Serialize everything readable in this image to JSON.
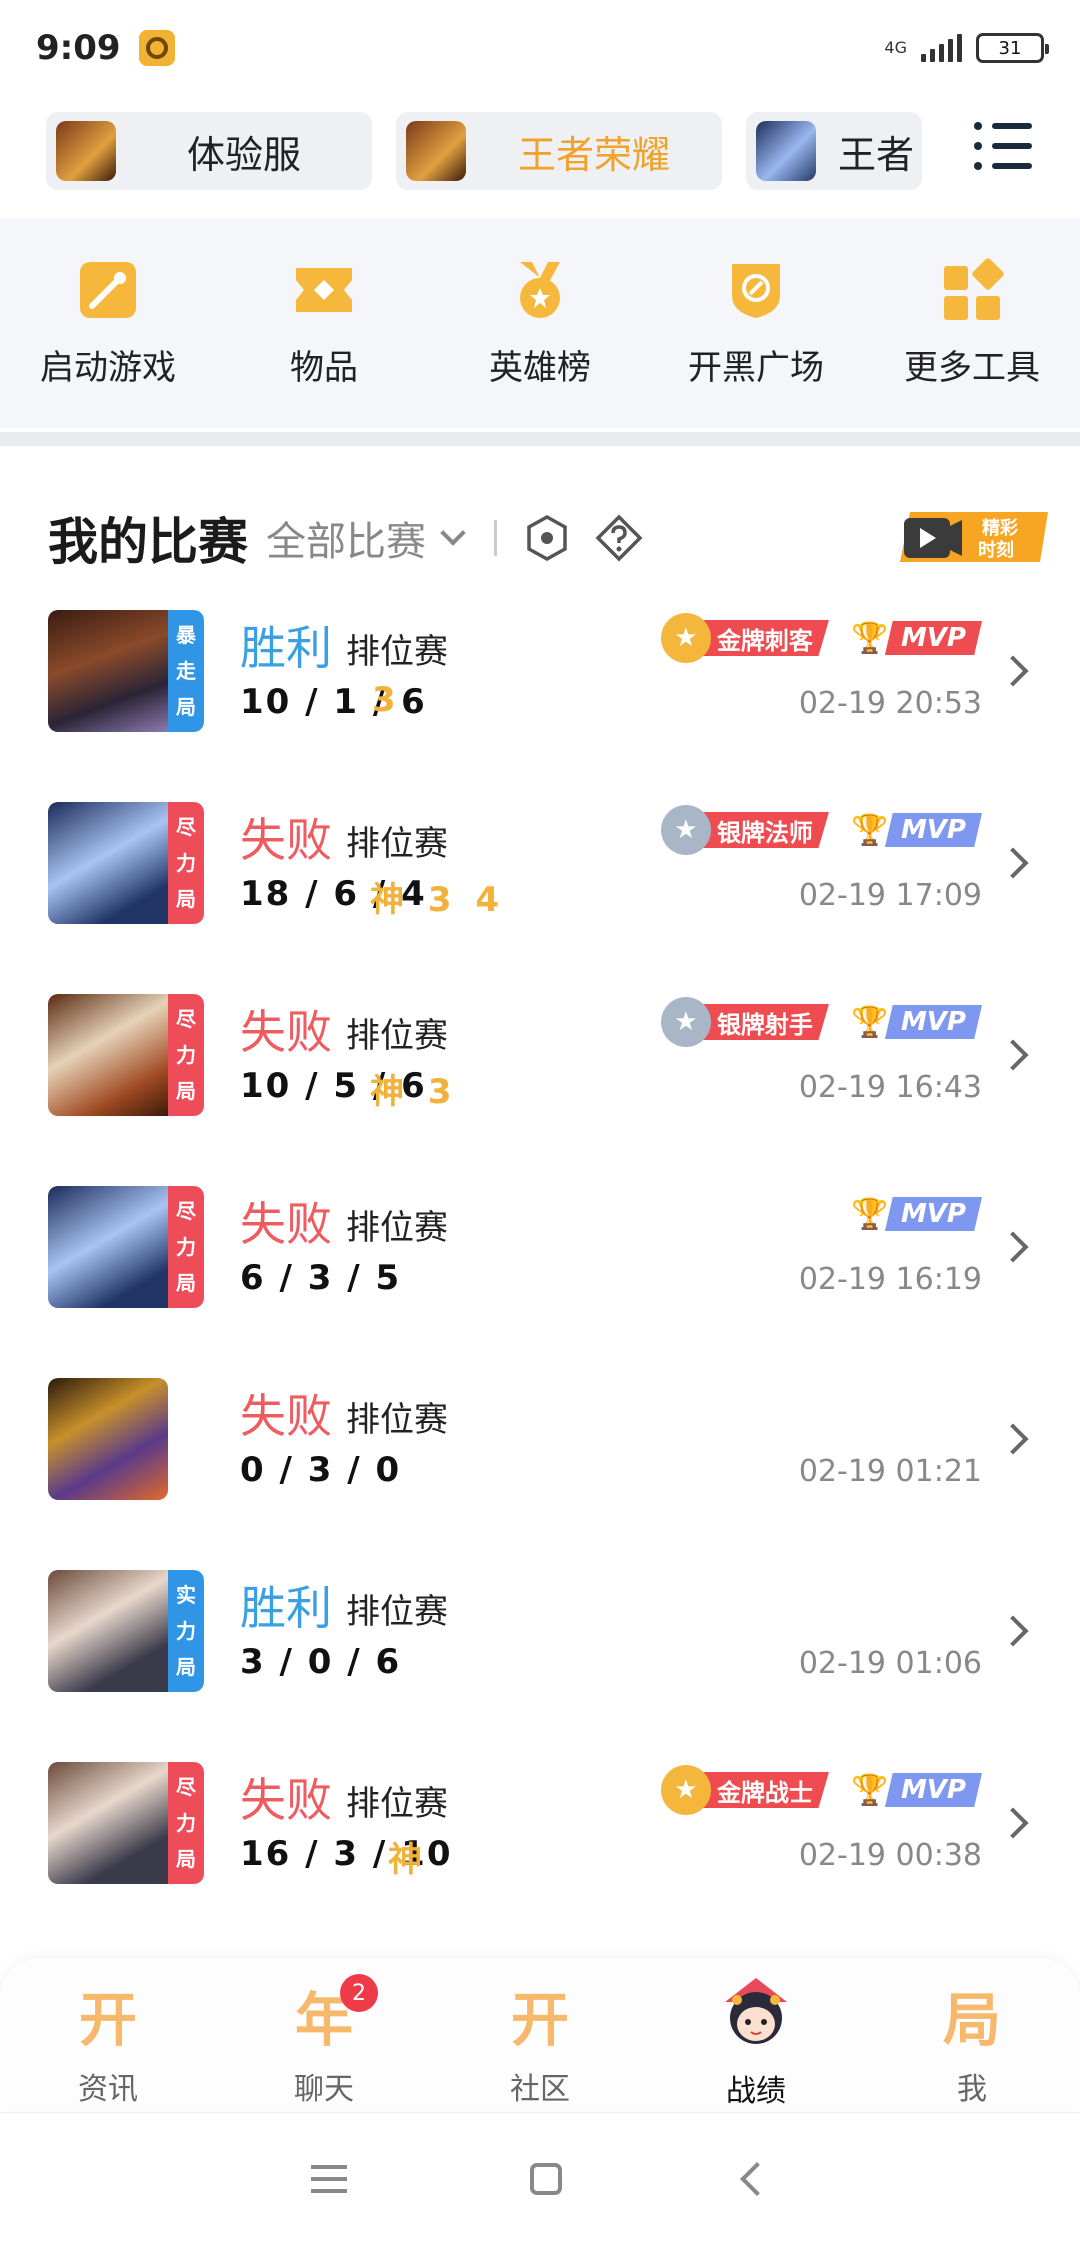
{
  "status_bar": {
    "time": "9:09",
    "network": "4G",
    "battery": "31"
  },
  "accounts": [
    {
      "label": "体验服"
    },
    {
      "label": "王者荣耀"
    },
    {
      "label": "王者"
    }
  ],
  "tools": [
    {
      "label": "启动游戏",
      "icon": "gamepad-icon"
    },
    {
      "label": "物品",
      "icon": "items-icon"
    },
    {
      "label": "英雄榜",
      "icon": "medal-icon"
    },
    {
      "label": "开黑广场",
      "icon": "compass-icon"
    },
    {
      "label": "更多工具",
      "icon": "grid-icon"
    }
  ],
  "section": {
    "title": "我的比赛",
    "filter": "全部比赛",
    "highlight_lines": [
      "精彩",
      "时刻"
    ]
  },
  "matches": [
    {
      "result": "胜利",
      "mode": "排位赛",
      "kda": "10 / 1 / 6",
      "marks": "3",
      "tag": [
        "暴",
        "走",
        "局"
      ],
      "medal": "金牌刺客",
      "mvp": "MVP",
      "time": "02-19 20:53"
    },
    {
      "result": "失败",
      "mode": "排位赛",
      "kda": "18 / 6 / 4",
      "marks": "神 3 4",
      "tag": [
        "尽",
        "力",
        "局"
      ],
      "medal": "银牌法师",
      "mvp": "MVP",
      "time": "02-19 17:09"
    },
    {
      "result": "失败",
      "mode": "排位赛",
      "kda": "10 / 5 / 6",
      "marks": "神 3",
      "tag": [
        "尽",
        "力",
        "局"
      ],
      "medal": "银牌射手",
      "mvp": "MVP",
      "time": "02-19 16:43"
    },
    {
      "result": "失败",
      "mode": "排位赛",
      "kda": "6 / 3 / 5",
      "marks": "",
      "tag": [
        "尽",
        "力",
        "局"
      ],
      "medal": "",
      "mvp": "MVP",
      "time": "02-19 16:19"
    },
    {
      "result": "失败",
      "mode": "排位赛",
      "kda": "0 / 3 / 0",
      "marks": "",
      "tag": [],
      "medal": "",
      "mvp": "",
      "time": "02-19 01:21"
    },
    {
      "result": "胜利",
      "mode": "排位赛",
      "kda": "3 / 0 / 6",
      "marks": "",
      "tag": [
        "实",
        "力",
        "局"
      ],
      "medal": "",
      "mvp": "",
      "time": "02-19 01:06"
    },
    {
      "result": "失败",
      "mode": "排位赛",
      "kda": "16 / 3 / 10",
      "marks": "神",
      "tag": [
        "尽",
        "力",
        "局"
      ],
      "medal": "金牌战士",
      "mvp": "MVP",
      "time": "02-19 00:38"
    }
  ],
  "bottom_nav": [
    {
      "glyph": "开",
      "label": "资讯"
    },
    {
      "glyph": "年",
      "label": "聊天",
      "badge": "2"
    },
    {
      "glyph": "开",
      "label": "社区"
    },
    {
      "glyph": "",
      "label": "战绩"
    },
    {
      "glyph": "局",
      "label": "我"
    }
  ],
  "colors": {
    "accent_orange": "#f0a22a",
    "win_blue": "#3b9fe4",
    "lose_red": "#ee5c5f",
    "mvp_blue": "#7d98ee",
    "medal_red": "#ee4c50"
  }
}
